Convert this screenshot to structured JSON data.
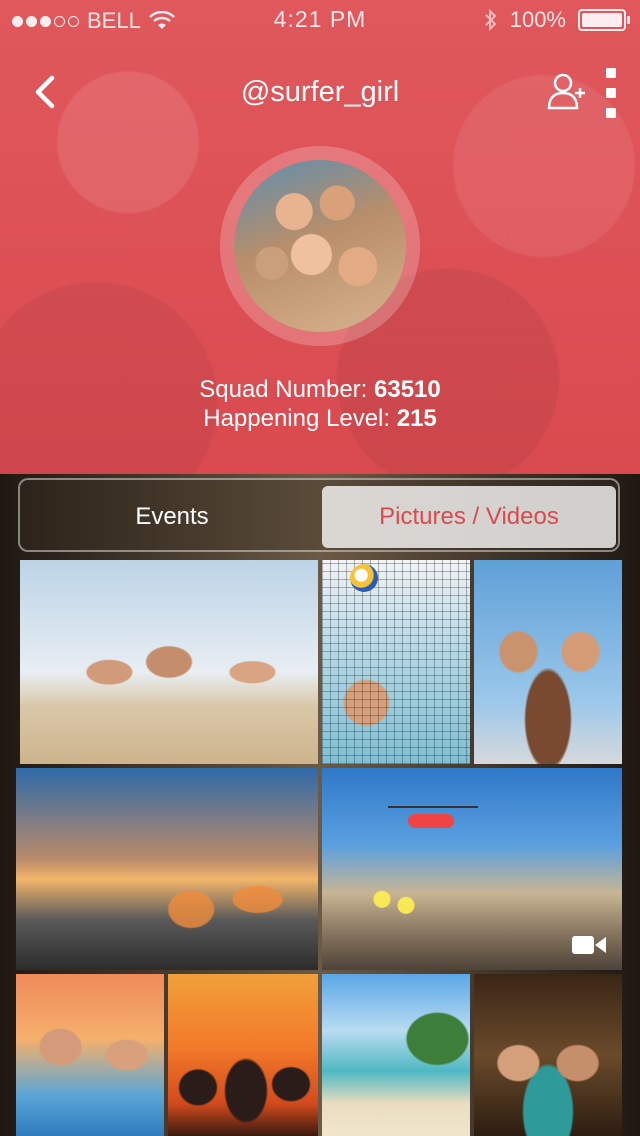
{
  "status_bar": {
    "carrier": "BELL",
    "time": "4:21 PM",
    "battery": "100%",
    "signal_bars_filled": 3,
    "signal_bars_total": 5
  },
  "header": {
    "title": "@surfer_girl",
    "back_icon": "chevron-left-icon",
    "add_user_icon": "add-user-icon",
    "more_icon": "more-vertical-icon"
  },
  "profile": {
    "squad_label": "Squad Number:",
    "squad_value": "63510",
    "happening_label": "Happening Level:",
    "happening_value": "215"
  },
  "segments": {
    "events": "Events",
    "pictures_videos": "Pictures / Videos",
    "selected": "pictures_videos"
  },
  "gallery": {
    "items": [
      {
        "type": "photo"
      },
      {
        "type": "photo"
      },
      {
        "type": "photo"
      },
      {
        "type": "photo"
      },
      {
        "type": "video"
      },
      {
        "type": "photo"
      },
      {
        "type": "photo"
      },
      {
        "type": "photo"
      },
      {
        "type": "photo"
      }
    ]
  },
  "colors": {
    "accent": "#d94a4f",
    "header_bg": "#e0585c"
  }
}
